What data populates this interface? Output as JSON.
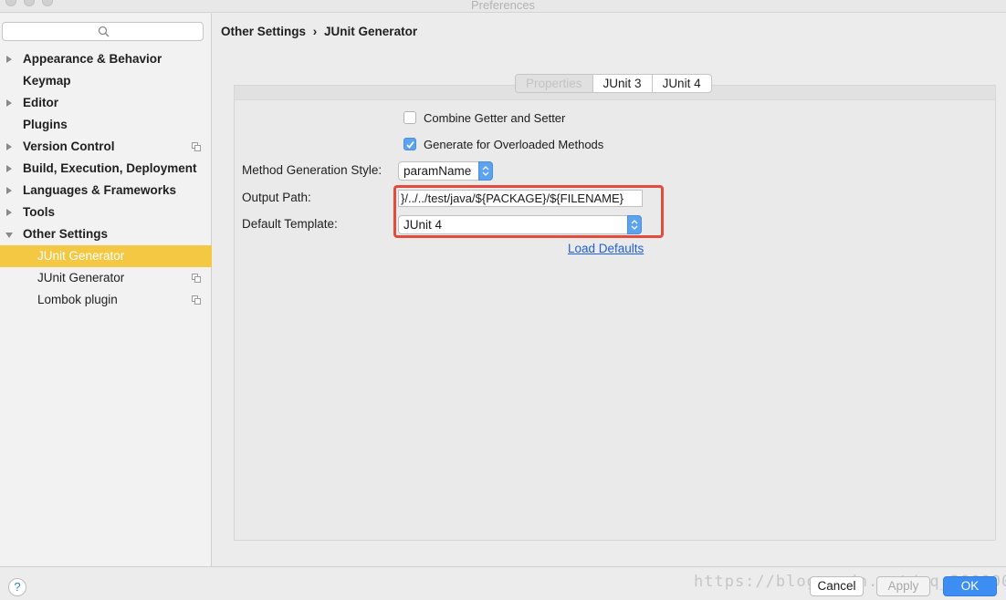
{
  "window": {
    "title": "Preferences"
  },
  "sidebar": {
    "search_placeholder": "",
    "items": [
      {
        "label": "Appearance & Behavior",
        "expandable": true
      },
      {
        "label": "Keymap",
        "expandable": false
      },
      {
        "label": "Editor",
        "expandable": true
      },
      {
        "label": "Plugins",
        "expandable": false
      },
      {
        "label": "Version Control",
        "expandable": true,
        "has_project_icon": true
      },
      {
        "label": "Build, Execution, Deployment",
        "expandable": true
      },
      {
        "label": "Languages & Frameworks",
        "expandable": true
      },
      {
        "label": "Tools",
        "expandable": true
      },
      {
        "label": "Other Settings",
        "expandable": true,
        "expanded": true
      }
    ],
    "subitems": [
      {
        "label": "JUnit Generator",
        "selected": true
      },
      {
        "label": "JUnit Generator",
        "has_project_icon": true
      },
      {
        "label": "Lombok plugin",
        "has_project_icon": true
      }
    ]
  },
  "breadcrumb": {
    "parent": "Other Settings",
    "separator": "›",
    "current": "JUnit Generator"
  },
  "tabs": [
    {
      "label": "Properties",
      "active": true
    },
    {
      "label": "JUnit 3",
      "active": false
    },
    {
      "label": "JUnit 4",
      "active": false
    }
  ],
  "form": {
    "combine_getter_setter": {
      "label": "Combine Getter and Setter",
      "checked": false
    },
    "generate_overloaded": {
      "label": "Generate for Overloaded Methods",
      "checked": true
    },
    "method_style": {
      "label": "Method Generation Style:",
      "value": "paramName"
    },
    "output_path": {
      "label": "Output Path:",
      "value": "}/../../test/java/${PACKAGE}/${FILENAME}"
    },
    "default_template": {
      "label": "Default Template:",
      "value": "JUnit 4"
    },
    "load_defaults": "Load Defaults"
  },
  "footer": {
    "help": "?",
    "cancel": "Cancel",
    "apply": "Apply",
    "ok": "OK",
    "watermark": "https://blog.csdn.net/qq_39000000"
  },
  "colors": {
    "selection": "#f4c842",
    "accent": "#3d8ef2",
    "highlight_border": "#e34b3a"
  }
}
